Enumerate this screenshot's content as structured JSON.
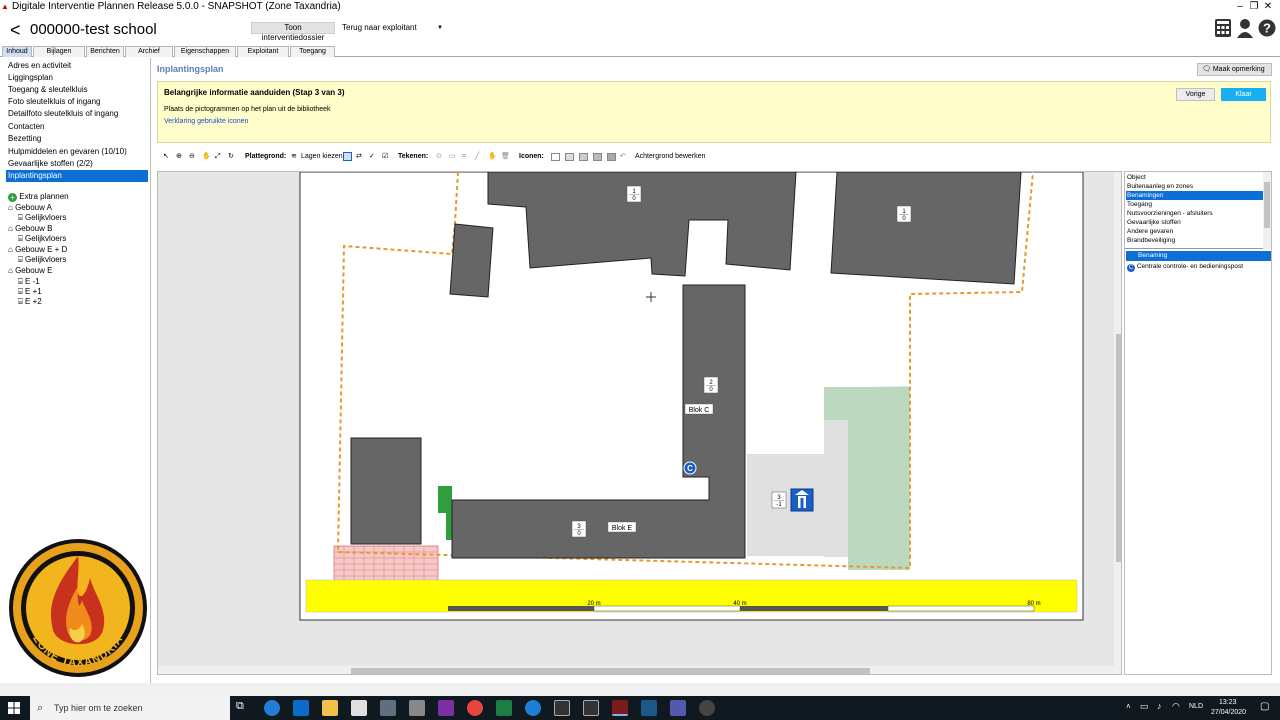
{
  "window": {
    "title": "Digitale Interventie Plannen Release 5.0.0 - SNAPSHOT (Zone Taxandria)"
  },
  "app": {
    "back_label": "<",
    "school_name": "000000-test school",
    "btn_dossier": "Toon interventiedossier",
    "exploitant_select": "Terug naar exploitant"
  },
  "tabs": [
    "Inhoud",
    "Bijlagen",
    "Berichten",
    "Archief",
    "Eigenschappen",
    "Exploitant",
    "Toegang"
  ],
  "nav": [
    "Adres en activiteit",
    "Liggingsplan",
    "Toegang & sleutelkluis",
    "Foto sleutelkluis of ingang",
    "Detailfoto sleutelkluis of ingang",
    "Contacten",
    "Bezetting",
    "Hulpmiddelen en gevaren (10/10)",
    "Gevaarlijke stoffen (2/2)",
    "Inplantingsplan"
  ],
  "tree": {
    "extra": "Extra plannen",
    "nodes": [
      {
        "label": "Gebouw A",
        "child": "Gelijkvloers"
      },
      {
        "label": "Gebouw B",
        "child": "Gelijkvloers"
      },
      {
        "label": "Gebouw E + D",
        "child": "Gelijkvloers"
      },
      {
        "label": "Gebouw E",
        "children": [
          "E -1",
          "E +1",
          "E +2"
        ]
      }
    ]
  },
  "main": {
    "title": "Inplantingsplan",
    "remark_btn": "Maak opmerking",
    "info_heading": "Belangrijke informatie aanduiden (Stap 3 van 3)",
    "info_text": "Plaats de pictogrammen op het plan uit de bibliotheek",
    "info_link": "Verklaring gebruikte iconen",
    "btn_prev": "Vorige",
    "btn_done": "Klaar"
  },
  "toolbar": {
    "plattegrond": "Plattegrond:",
    "lagen": "Lagen kiezen",
    "tekenen": "Tekenen:",
    "iconen": "Iconen:",
    "achtergrond": "Achtergrond bewerken"
  },
  "map": {
    "labels": {
      "blok_c": "Blok C",
      "blok_e": "Blok E"
    },
    "floors": [
      {
        "top": "1",
        "bot": "0"
      },
      {
        "top": "1",
        "bot": "0"
      },
      {
        "top": "2",
        "bot": "0"
      },
      {
        "top": "3",
        "bot": "0"
      },
      {
        "top": "3",
        "bot": "-1"
      }
    ],
    "scale": [
      "20 m",
      "40 m",
      "80 m"
    ],
    "marker_c": "C",
    "logo_text": "ZONE TAXANDRIA"
  },
  "right": {
    "list": [
      "Object",
      "Buitenaanleg en zones",
      "Benamingen",
      "Toegang",
      "Nutsvoorzieningen - afsluiters",
      "Gevaarlijke stoffen",
      "Andere gevaren",
      "Brandbeveiliging"
    ],
    "selected_index": 2,
    "detail_header": "Benaming",
    "detail_item": "Centrale controle- en bedieningspost"
  },
  "taskbar": {
    "search": "Typ hier om te zoeken",
    "lang": "NLD",
    "time": "13:23",
    "date": "27/04/2020"
  },
  "colors": {
    "accent": "#0b6fd6",
    "building": "#666666",
    "boundary": "#e69a2e",
    "road": "#ffff00",
    "green": "#bcd9bf",
    "green_dark": "#2e9e3e",
    "info_bg": "#fffdc9",
    "klaar": "#1aaef0"
  }
}
